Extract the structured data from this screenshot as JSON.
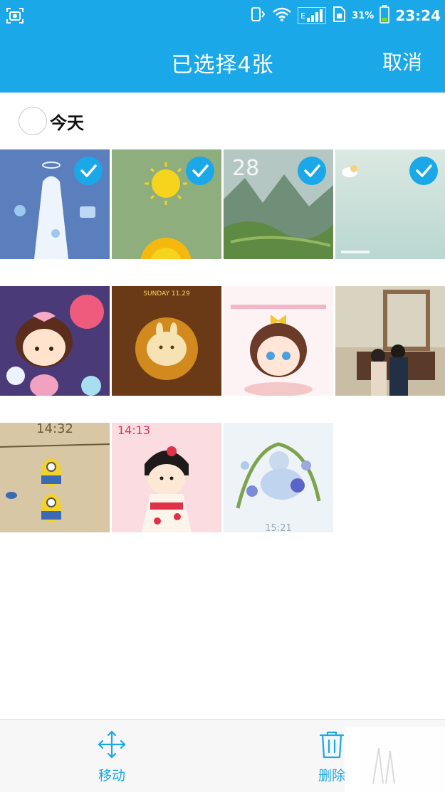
{
  "status_bar": {
    "battery_percent": "31%",
    "time": "23:24",
    "network_type": "E",
    "icons": [
      "screenshot-icon",
      "vibrate-icon",
      "wifi-icon",
      "signal-icon",
      "sim-icon",
      "battery-icon"
    ]
  },
  "title_bar": {
    "title": "已选择4张",
    "cancel_label": "取消"
  },
  "section": {
    "label": "今天"
  },
  "photos": [
    {
      "id": "photo-1",
      "selected": true,
      "clock": ""
    },
    {
      "id": "photo-2",
      "selected": true,
      "clock": ""
    },
    {
      "id": "photo-3",
      "selected": true,
      "clock": "28"
    },
    {
      "id": "photo-4",
      "selected": true,
      "clock": ""
    },
    {
      "id": "photo-5",
      "selected": false,
      "clock": ""
    },
    {
      "id": "photo-6",
      "selected": false,
      "clock": "SUNDAY 11.29"
    },
    {
      "id": "photo-7",
      "selected": false,
      "clock": ""
    },
    {
      "id": "photo-8",
      "selected": false,
      "clock": ""
    },
    {
      "id": "photo-9",
      "selected": false,
      "clock": "14:32"
    },
    {
      "id": "photo-10",
      "selected": false,
      "clock": "14:13"
    },
    {
      "id": "photo-11",
      "selected": false,
      "clock": "15:21"
    }
  ],
  "bottom_bar": {
    "move_label": "移动",
    "delete_label": "删除"
  },
  "colors": {
    "accent": "#1aa8e8",
    "bottom_bar_bg": "#f7f7f7"
  }
}
